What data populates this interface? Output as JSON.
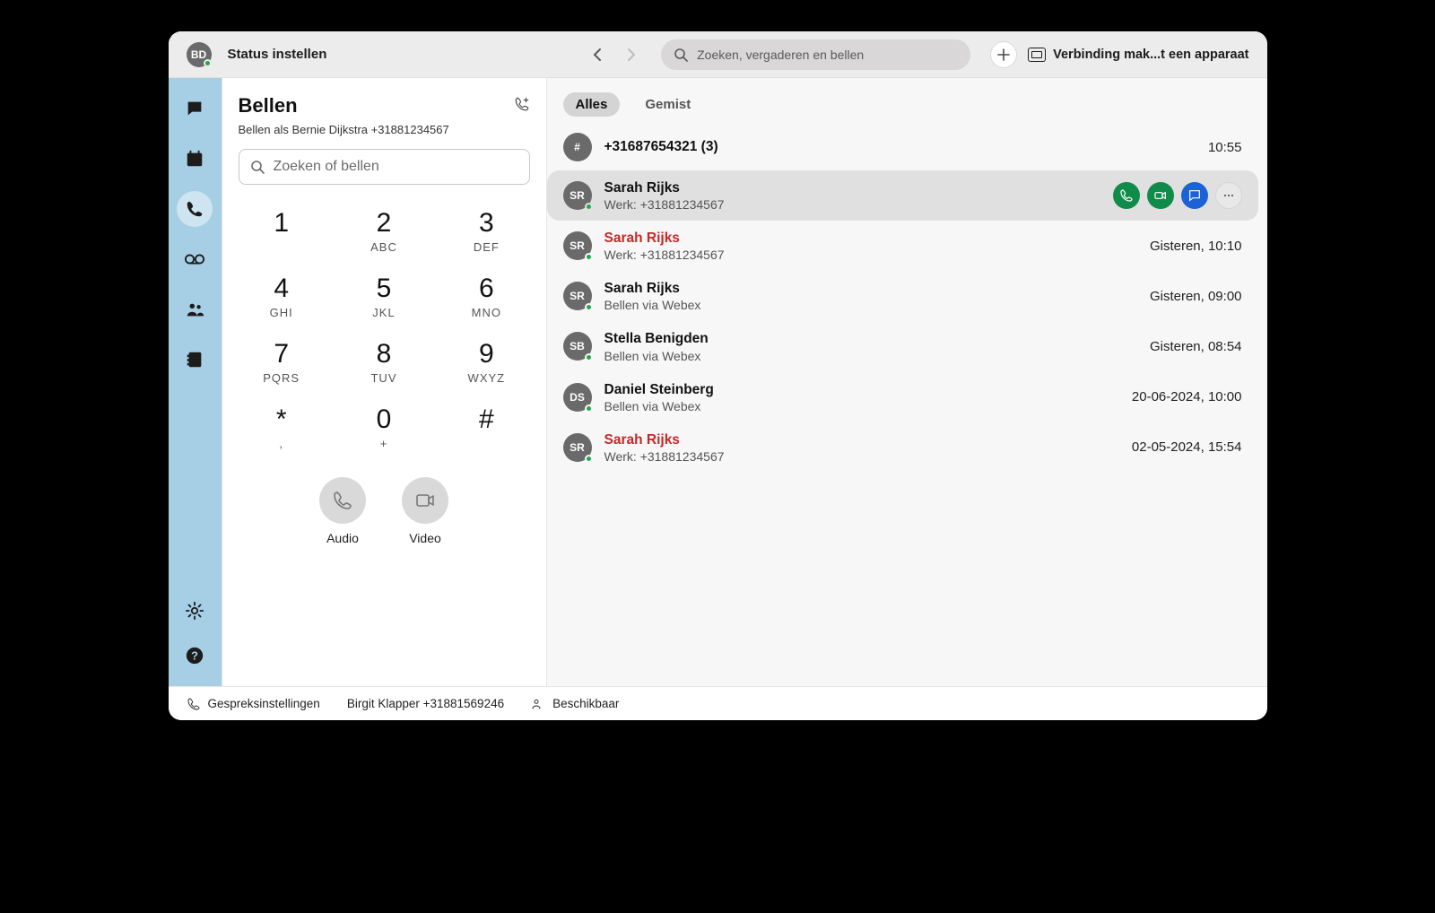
{
  "header": {
    "user_initials": "BD",
    "status_label": "Status instellen",
    "search_placeholder": "Zoeken, vergaderen en bellen",
    "connect_device_label": "Verbinding mak...t een apparaat"
  },
  "rail": {
    "items": [
      {
        "name": "messaging",
        "active": false
      },
      {
        "name": "meetings",
        "active": false
      },
      {
        "name": "calling",
        "active": true
      },
      {
        "name": "voicemail",
        "active": false
      },
      {
        "name": "teams",
        "active": false
      },
      {
        "name": "contacts",
        "active": false
      }
    ]
  },
  "dialer": {
    "title": "Bellen",
    "calling_as": "Bellen als Bernie Dijkstra +31881234567",
    "search_placeholder": "Zoeken of bellen",
    "keys": [
      {
        "num": "1",
        "letters": ""
      },
      {
        "num": "2",
        "letters": "ABC"
      },
      {
        "num": "3",
        "letters": "DEF"
      },
      {
        "num": "4",
        "letters": "GHI"
      },
      {
        "num": "5",
        "letters": "JKL"
      },
      {
        "num": "6",
        "letters": "MNO"
      },
      {
        "num": "7",
        "letters": "PQRS"
      },
      {
        "num": "8",
        "letters": "TUV"
      },
      {
        "num": "9",
        "letters": "WXYZ"
      },
      {
        "num": "*",
        "letters": ","
      },
      {
        "num": "0",
        "letters": "+"
      },
      {
        "num": "#",
        "letters": ""
      }
    ],
    "audio_label": "Audio",
    "video_label": "Video"
  },
  "history": {
    "tabs": {
      "all": "Alles",
      "missed": "Gemist"
    },
    "active_tab": "all",
    "records": [
      {
        "initials": "#",
        "name": "+31687654321 (3)",
        "meta": "",
        "time": "10:55",
        "missed": false,
        "selected": false,
        "presence": false,
        "actions": false
      },
      {
        "initials": "SR",
        "name": "Sarah Rijks",
        "meta": "Werk: +31881234567",
        "time": "",
        "missed": false,
        "selected": true,
        "presence": true,
        "actions": true
      },
      {
        "initials": "SR",
        "name": "Sarah Rijks",
        "meta": "Werk: +31881234567",
        "time": "Gisteren, 10:10",
        "missed": true,
        "selected": false,
        "presence": true,
        "actions": false
      },
      {
        "initials": "SR",
        "name": "Sarah Rijks",
        "meta": "Bellen via Webex",
        "time": "Gisteren, 09:00",
        "missed": false,
        "selected": false,
        "presence": true,
        "actions": false
      },
      {
        "initials": "SB",
        "name": "Stella Benigden",
        "meta": "Bellen via Webex",
        "time": "Gisteren, 08:54",
        "missed": false,
        "selected": false,
        "presence": true,
        "actions": false
      },
      {
        "initials": "DS",
        "name": "Daniel Steinberg",
        "meta": "Bellen via Webex",
        "time": "20-06-2024, 10:00",
        "missed": false,
        "selected": false,
        "presence": true,
        "actions": false
      },
      {
        "initials": "SR",
        "name": "Sarah Rijks",
        "meta": "Werk: +31881234567",
        "time": "02-05-2024, 15:54",
        "missed": true,
        "selected": false,
        "presence": true,
        "actions": false
      }
    ]
  },
  "footer": {
    "conv_settings": "Gespreksinstellingen",
    "secondary_line": "Birgit Klapper +31881569246",
    "presence_label": "Beschikbaar"
  }
}
